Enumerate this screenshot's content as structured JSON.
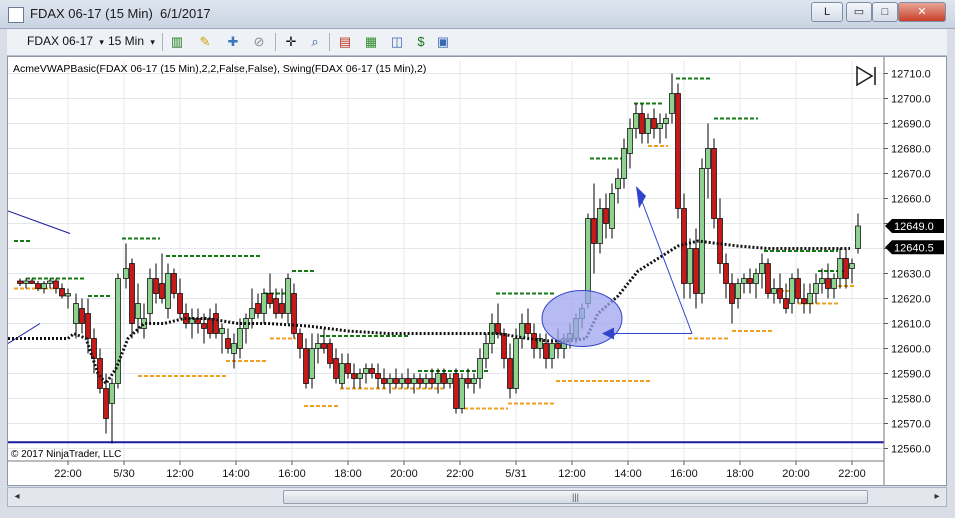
{
  "window": {
    "title": "FDAX 06-17 (15 Min)  6/1/2017",
    "buttons": {
      "l_label": "L",
      "minimize": "▭",
      "maximize": "□",
      "close": "✕"
    }
  },
  "toolbar": {
    "instrument": "FDAX 06-17",
    "interval": "15 Min",
    "dropdown_glyph": "▾"
  },
  "chart": {
    "indicator_label": "AcmeVWAPBasic(FDAX 06-17 (15 Min),2,2,False,False), Swing(FDAX 06-17 (15 Min),2)",
    "copyright": "© 2017 NinjaTrader, LLC",
    "price_axis": {
      "min": 12555,
      "max": 12715,
      "ticks": [
        "12710.0",
        "12700.0",
        "12690.0",
        "12680.0",
        "12670.0",
        "12660.0",
        "12650.0",
        "12640.0",
        "12630.0",
        "12620.0",
        "12610.0",
        "12600.0",
        "12590.0",
        "12580.0",
        "12570.0",
        "12560.0"
      ]
    },
    "price_flags": [
      {
        "label": "12649.0",
        "price": 12649
      },
      {
        "label": "12640.5",
        "price": 12640.5
      }
    ],
    "time_axis": {
      "labels": [
        "22:00",
        "5/30",
        "12:00",
        "14:00",
        "16:00",
        "18:00",
        "20:00",
        "22:00",
        "5/31",
        "12:00",
        "14:00",
        "16:00",
        "18:00",
        "20:00",
        "22:00"
      ]
    },
    "colors": {
      "up_candle": "#8fd18f",
      "down_candle": "#c41a1a",
      "swing_high": "#117a11",
      "swing_low": "#f0a020",
      "vwap": "#111111",
      "horizontal_line": "#1a1aa0",
      "annotation": "#3344cc",
      "ellipse_fill": "#9da6ef"
    }
  }
}
